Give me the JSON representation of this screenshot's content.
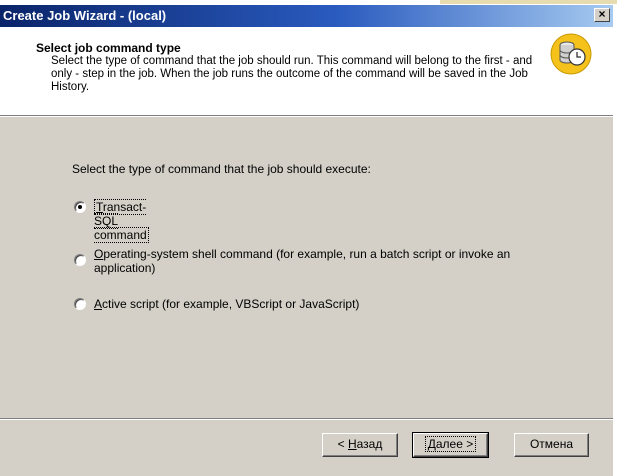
{
  "window": {
    "title": "Create Job Wizard - (local)",
    "close_label": "×"
  },
  "header": {
    "title": "Select job command type",
    "description": "Select the type of command that the job should run.  This command will belong to the first - and only - step in the job.  When the job runs the outcome of the command will be saved in the Job History.",
    "icon": "database-clock-icon"
  },
  "body": {
    "prompt": "Select the type of command that the job should execute:",
    "options": [
      {
        "key": "T",
        "rest": "ransact-SQL command",
        "label": "Transact-SQL command",
        "selected": true
      },
      {
        "key": "O",
        "rest": "perating-system shell command (for example, run a batch script or invoke an application)",
        "label": "Operating-system shell command (for example, run a batch script or invoke an application)",
        "selected": false
      },
      {
        "key": "A",
        "rest": "ctive script (for example, VBScript or JavaScript)",
        "label": "Active script (for example, VBScript or JavaScript)",
        "selected": false
      }
    ]
  },
  "buttons": {
    "back_prefix": "< ",
    "back_key": "Н",
    "back_rest": "азад",
    "next_key": "Д",
    "next_rest": "алее >",
    "cancel": "Отмена"
  },
  "colors": {
    "titlebar": "#0a246a",
    "dialog_face": "#d4d0c8",
    "header_bg": "#ffffff"
  }
}
